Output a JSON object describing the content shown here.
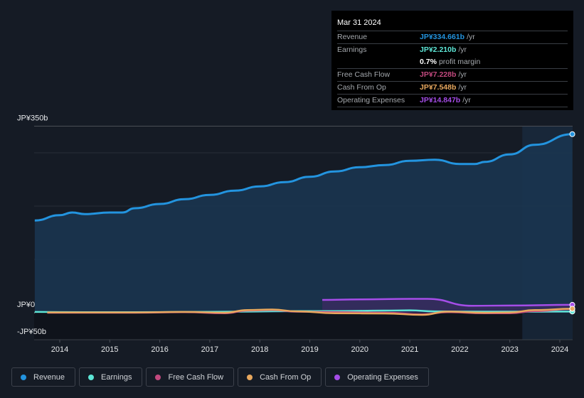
{
  "tooltip": {
    "date": "Mar 31 2024",
    "rows": [
      {
        "label": "Revenue",
        "value": "JP¥334.661b",
        "unit": "/yr",
        "color": "#2394df"
      },
      {
        "label": "Earnings",
        "value": "JP¥2.210b",
        "unit": "/yr",
        "color": "#5de6d6"
      },
      {
        "label": "",
        "value": "0.7%",
        "unit": "profit margin",
        "color": "#ffffff"
      },
      {
        "label": "Free Cash Flow",
        "value": "JP¥7.228b",
        "unit": "/yr",
        "color": "#c2497e"
      },
      {
        "label": "Cash From Op",
        "value": "JP¥7.548b",
        "unit": "/yr",
        "color": "#e8a85e"
      },
      {
        "label": "Operating Expenses",
        "value": "JP¥14.847b",
        "unit": "/yr",
        "color": "#a54de8"
      }
    ]
  },
  "legend": [
    {
      "label": "Revenue",
      "color": "#2394df"
    },
    {
      "label": "Earnings",
      "color": "#5de6d6"
    },
    {
      "label": "Free Cash Flow",
      "color": "#c2497e"
    },
    {
      "label": "Cash From Op",
      "color": "#e8a85e"
    },
    {
      "label": "Operating Expenses",
      "color": "#a54de8"
    }
  ],
  "chart_data": {
    "type": "area",
    "title": "",
    "xlabel": "",
    "ylabel": "",
    "y_tick_labels": [
      "JP¥350b",
      "JP¥0",
      "-JP¥50b"
    ],
    "ylim": [
      -50,
      350
    ],
    "y_unit": "JP¥ billions",
    "x_ticks": [
      2014,
      2015,
      2016,
      2017,
      2018,
      2019,
      2020,
      2021,
      2022,
      2023,
      2024
    ],
    "x_tick_labels": [
      "2014",
      "2015",
      "2016",
      "2017",
      "2018",
      "2019",
      "2020",
      "2021",
      "2022",
      "2023",
      "2024"
    ],
    "xlim": [
      2013.0,
      2024.25
    ],
    "forecast_shade_start": 2023.25,
    "grid": true,
    "legend_position": "bottom",
    "series": [
      {
        "name": "Revenue",
        "color": "#2394df",
        "x": [
          2013.5,
          2014.0,
          2014.25,
          2014.5,
          2015.0,
          2015.25,
          2015.5,
          2016.0,
          2016.5,
          2017.0,
          2017.5,
          2018.0,
          2018.5,
          2019.0,
          2019.5,
          2020.0,
          2020.5,
          2021.0,
          2021.5,
          2022.0,
          2022.3,
          2022.5,
          2023.0,
          2023.5,
          2024.25
        ],
        "values": [
          173,
          183,
          188,
          185,
          188,
          188,
          196,
          204,
          213,
          221,
          229,
          237,
          245,
          255,
          265,
          273,
          277,
          285,
          287,
          279,
          279,
          283,
          297,
          315,
          335
        ]
      },
      {
        "name": "Earnings",
        "color": "#5de6d6",
        "x": [
          2013.5,
          2014.5,
          2015.5,
          2016.5,
          2017.5,
          2018.5,
          2019.5,
          2020.5,
          2021.0,
          2021.5,
          2022.5,
          2023.5,
          2024.25
        ],
        "values": [
          1.5,
          1.0,
          1.0,
          1.5,
          2.0,
          3.0,
          3.0,
          4.0,
          4.5,
          2.5,
          2.0,
          2.0,
          2.2
        ]
      },
      {
        "name": "Free Cash Flow",
        "color": "#c2497e",
        "x": [
          2013.75,
          2014.5,
          2015.5,
          2016.5,
          2017.3,
          2017.75,
          2018.25,
          2018.75,
          2019.5,
          2020.5,
          2021.25,
          2021.75,
          2022.5,
          2023.0,
          2023.5,
          2024.25
        ],
        "values": [
          0,
          0,
          0,
          1,
          -1,
          4,
          5,
          2,
          1,
          0,
          -3,
          1,
          -1,
          -1,
          3,
          7.2
        ]
      },
      {
        "name": "Cash From Op",
        "color": "#e8a85e",
        "x": [
          2013.75,
          2014.5,
          2015.5,
          2016.5,
          2017.3,
          2017.75,
          2018.25,
          2018.75,
          2019.5,
          2020.5,
          2021.25,
          2021.75,
          2022.5,
          2023.0,
          2023.5,
          2024.25
        ],
        "values": [
          0.5,
          0.5,
          0.5,
          1.5,
          0,
          5,
          6,
          2.5,
          -1,
          -1.5,
          -4,
          2,
          0,
          0.5,
          5,
          7.5
        ]
      },
      {
        "name": "Operating Expenses",
        "color": "#a54de8",
        "x": [
          2019.25,
          2020.0,
          2021.0,
          2021.35,
          2022.25,
          2023.0,
          2024.25
        ],
        "values": [
          24,
          25,
          26,
          26,
          13,
          13.5,
          14.8
        ]
      }
    ]
  }
}
